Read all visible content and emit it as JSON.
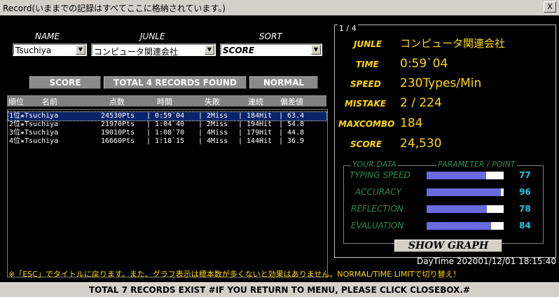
{
  "window": {
    "title": "Record(いままでの記録はすべてここに格納されています。)",
    "close": "X"
  },
  "filters": {
    "name": {
      "label": "NAME",
      "value": "Tsuchiya"
    },
    "junle": {
      "label": "JUNLE",
      "value": "コンピュータ関連会社"
    },
    "sort": {
      "label": "SORT",
      "value": "SCORE"
    }
  },
  "buttons": {
    "score": "SCORE",
    "found": "TOTAL 4 RECORDS FOUND",
    "normal": "NORMAL"
  },
  "table": {
    "headers": [
      "順位",
      "名前",
      "点数",
      "時間",
      "失敗",
      "連続",
      "偏差値"
    ],
    "rows": [
      {
        "rank": "1位★Tsuchiya",
        "pts": "24530Pts",
        "time": "| 0:59`04",
        "miss": "| 2Miss",
        "hit": "| 184Hit",
        "dev": "|  63.4"
      },
      {
        "rank": "2位★Tsuchiya",
        "pts": "21970Pts",
        "time": "| 1:04`40",
        "miss": "| 2Miss",
        "hit": "| 194Hit",
        "dev": "|  54.8"
      },
      {
        "rank": "3位★Tsuchiya",
        "pts": "19010Pts",
        "time": "| 1:08`70",
        "miss": "| 4Miss",
        "hit": "| 179Hit",
        "dev": "|  44.8"
      },
      {
        "rank": "4位★Tsuchiya",
        "pts": "16660Pts",
        "time": "| 1:18`15",
        "miss": "| 4Miss",
        "hit": "| 144Hit",
        "dev": "|  36.9"
      }
    ]
  },
  "detail": {
    "page": "1 / 4",
    "junle": {
      "label": "JUNLE",
      "value": "コンピュータ関連会社"
    },
    "time": {
      "label": "TIME",
      "value": "0:59`04"
    },
    "speed": {
      "label": "SPEED",
      "value": "230Types/Min"
    },
    "mistake": {
      "label": "MISTAKE",
      "value": "2 / 224"
    },
    "maxcombo": {
      "label": "MAXCOMBO",
      "value": "184"
    },
    "score": {
      "label": "SCORE",
      "value": "24,530"
    }
  },
  "yourdata": {
    "title": "YOUR DATA",
    "param_title": "PARAMETER / POINT",
    "items": [
      {
        "label": "TYPING SPEED",
        "value": "77"
      },
      {
        "label": "ACCURACY",
        "value": "96"
      },
      {
        "label": "REFLECTION",
        "value": "78"
      },
      {
        "label": "EVALUATION",
        "value": "84"
      }
    ]
  },
  "show_graph": "SHOW GRAPH",
  "daytime": "DayTime 202001/12/01 18:15:40",
  "note": "※「ESC」でタイトルに戻ります。また、グラフ表示は標本数が多くないと効果はありません。NORMAL/TIME LIMITで切り替え！",
  "status": "TOTAL 7 RECORDS EXIST    #IF YOU RETURN TO MENU, PLEASE CLICK CLOSEBOX.#",
  "colors": {
    "accent": "#ffd800",
    "label_green": "#2e8b57",
    "bar_fill": "#6a6ae0",
    "pct_cyan": "#1ec8e6",
    "selection": "#0a246a"
  }
}
